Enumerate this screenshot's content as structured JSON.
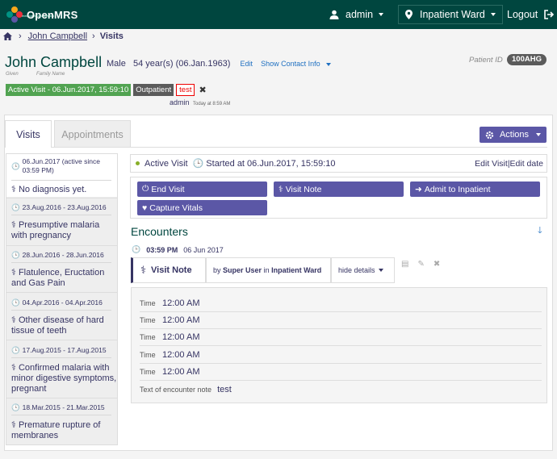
{
  "header": {
    "logo_text": "OpenMRS",
    "logo_subtext": "medical record system",
    "user": "admin",
    "location": "Inpatient Ward",
    "logout": "Logout"
  },
  "breadcrumb": {
    "patient": "John Campbell",
    "current": "Visits"
  },
  "patient": {
    "name": "John Campbell",
    "given_label": "Given",
    "family_label": "Family Name",
    "gender": "Male",
    "age": "54 year(s) (06.Jan.1963)",
    "edit": "Edit",
    "show_contact": "Show Contact Info",
    "id_label": "Patient ID",
    "id": "100AHG"
  },
  "tags": {
    "active_visit": "Active Visit - 06.Jun.2017, 15:59:10",
    "outpatient": "Outpatient",
    "test": "test",
    "remove": "✖",
    "by": "admin",
    "time": "Today at 8:59 AM"
  },
  "tabs": {
    "visits": "Visits",
    "appointments": "Appointments",
    "actions": "Actions"
  },
  "visit_list": [
    {
      "date": "06.Jun.2017 (active since 03:59 PM)",
      "diagnosis": "No diagnosis yet."
    },
    {
      "date": "23.Aug.2016 - 23.Aug.2016",
      "diagnosis": "Presumptive malaria with pregnancy"
    },
    {
      "date": "28.Jun.2016 - 28.Jun.2016",
      "diagnosis": "Flatulence, Eructation and Gas Pain"
    },
    {
      "date": "04.Apr.2016 - 04.Apr.2016",
      "diagnosis": "Other disease of hard tissue of teeth"
    },
    {
      "date": "17.Aug.2015 - 17.Aug.2015",
      "diagnosis": "Confirmed malaria with minor digestive symptoms, pregnant"
    },
    {
      "date": "18.Mar.2015 - 21.Mar.2015",
      "diagnosis": "Premature rupture of membranes"
    }
  ],
  "visit_detail": {
    "status": "Active Visit",
    "started": "Started at 06.Jun.2017, 15:59:10",
    "edit_visit": "Edit Visit",
    "edit_date": "Edit date",
    "buttons": {
      "end_visit": "End Visit",
      "visit_note": "Visit Note",
      "admit": "Admit to Inpatient",
      "capture_vitals": "Capture Vitals"
    }
  },
  "encounters": {
    "title": "Encounters",
    "time": "03:59 PM",
    "date": "06 Jun 2017",
    "type": "Visit Note",
    "by_prefix": "by",
    "by_user": "Super User",
    "in_prefix": "in",
    "location": "Inpatient Ward",
    "hide_details": "hide details",
    "observations": [
      {
        "label": "Time",
        "value": "12:00 AM"
      },
      {
        "label": "Time",
        "value": "12:00 AM"
      },
      {
        "label": "Time",
        "value": "12:00 AM"
      },
      {
        "label": "Time",
        "value": "12:00 AM"
      },
      {
        "label": "Time",
        "value": "12:00 AM"
      }
    ],
    "note_label": "Text of encounter note",
    "note_value": "test"
  }
}
